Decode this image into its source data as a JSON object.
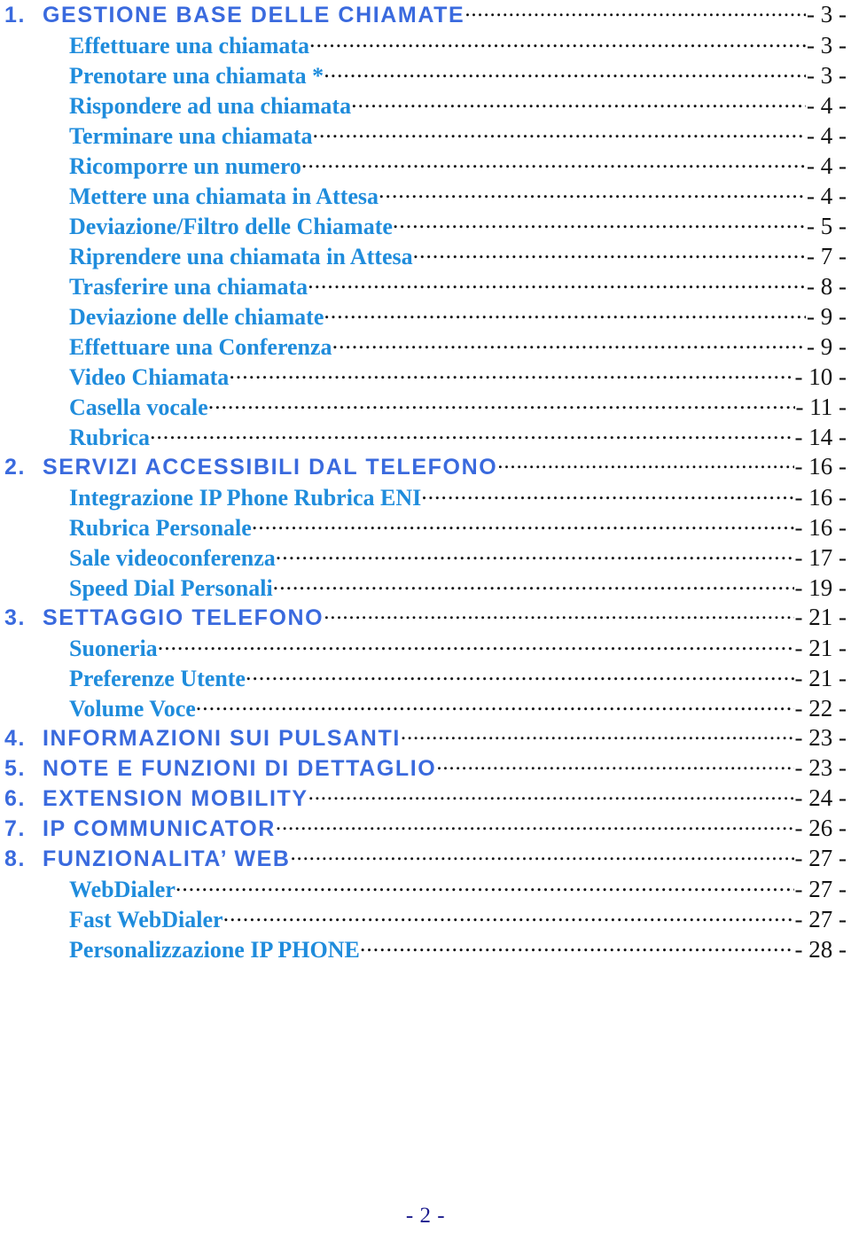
{
  "document": {
    "type": "table-of-contents",
    "language": "it",
    "colors": {
      "chapter_blue": "#3a6ade",
      "entry_blue": "#1f8cdc",
      "leader_black": "#111111",
      "footer_navy": "#1d1d8e",
      "background": "#ffffff"
    }
  },
  "entries": [
    {
      "level": 1,
      "number": "1.",
      "label": "GESTIONE BASE DELLE CHIAMATE",
      "page": "- 3 -"
    },
    {
      "level": 2,
      "number": "",
      "label": "Effettuare una chiamata",
      "page": "- 3 -"
    },
    {
      "level": 2,
      "number": "",
      "label": "Prenotare una chiamata *",
      "page": "- 3 -"
    },
    {
      "level": 2,
      "number": "",
      "label": "Rispondere ad una chiamata",
      "page": "- 4 -"
    },
    {
      "level": 2,
      "number": "",
      "label": "Terminare una chiamata",
      "page": "- 4 -"
    },
    {
      "level": 2,
      "number": "",
      "label": "Ricomporre un numero",
      "page": "- 4 -"
    },
    {
      "level": 2,
      "number": "",
      "label": "Mettere una chiamata in Attesa",
      "page": "- 4 -"
    },
    {
      "level": 2,
      "number": "",
      "label": "Deviazione/Filtro delle Chiamate",
      "page": "- 5 -"
    },
    {
      "level": 2,
      "number": "",
      "label": "Riprendere una chiamata in Attesa",
      "page": "- 7 -"
    },
    {
      "level": 2,
      "number": "",
      "label": "Trasferire una chiamata",
      "page": "- 8 -"
    },
    {
      "level": 2,
      "number": "",
      "label": "Deviazione delle chiamate",
      "page": "- 9 -"
    },
    {
      "level": 2,
      "number": "",
      "label": "Effettuare una Conferenza",
      "page": "- 9 -"
    },
    {
      "level": 2,
      "number": "",
      "label": "Video Chiamata",
      "page": "- 10 -"
    },
    {
      "level": 2,
      "number": "",
      "label": "Casella vocale",
      "page": "- 11 -"
    },
    {
      "level": 2,
      "number": "",
      "label": "Rubrica",
      "page": "- 14 -"
    },
    {
      "level": 1,
      "number": "2.",
      "label": "SERVIZI ACCESSIBILI DAL TELEFONO",
      "page": "- 16 -"
    },
    {
      "level": 2,
      "number": "",
      "label": "Integrazione IP Phone Rubrica ENI",
      "page": "- 16 -"
    },
    {
      "level": 2,
      "number": "",
      "label": "Rubrica Personale",
      "page": "- 16 -"
    },
    {
      "level": 2,
      "number": "",
      "label": "Sale videoconferenza",
      "page": "- 17 -"
    },
    {
      "level": 2,
      "number": "",
      "label": "Speed Dial Personali",
      "page": "- 19 -"
    },
    {
      "level": 1,
      "number": "3.",
      "label": "SETTAGGIO TELEFONO",
      "page": "- 21 -"
    },
    {
      "level": 2,
      "number": "",
      "label": "Suoneria",
      "page": "- 21 -"
    },
    {
      "level": 2,
      "number": "",
      "label": "Preferenze Utente",
      "page": "- 21 -"
    },
    {
      "level": 2,
      "number": "",
      "label": "Volume Voce",
      "page": "- 22 -"
    },
    {
      "level": 1,
      "number": "4.",
      "label": "INFORMAZIONI SUI PULSANTI",
      "page": "- 23 -"
    },
    {
      "level": 1,
      "number": "5.",
      "label": "NOTE E FUNZIONI DI DETTAGLIO",
      "page": "- 23 -"
    },
    {
      "level": 1,
      "number": "6.",
      "label": "EXTENSION MOBILITY",
      "page": "- 24 -"
    },
    {
      "level": 1,
      "number": "7.",
      "label": "IP COMMUNICATOR",
      "page": "- 26 -"
    },
    {
      "level": 1,
      "number": "8.",
      "label": "FUNZIONALITA’ WEB",
      "page": "- 27 -"
    },
    {
      "level": 2,
      "number": "",
      "label": "WebDialer",
      "page": "- 27 -"
    },
    {
      "level": 2,
      "number": "",
      "label": "Fast WebDialer",
      "page": "- 27 -"
    },
    {
      "level": 2,
      "number": "",
      "label": "Personalizzazione IP PHONE",
      "page": "- 28 -"
    }
  ],
  "footer": {
    "page_label": "- 2 -"
  }
}
